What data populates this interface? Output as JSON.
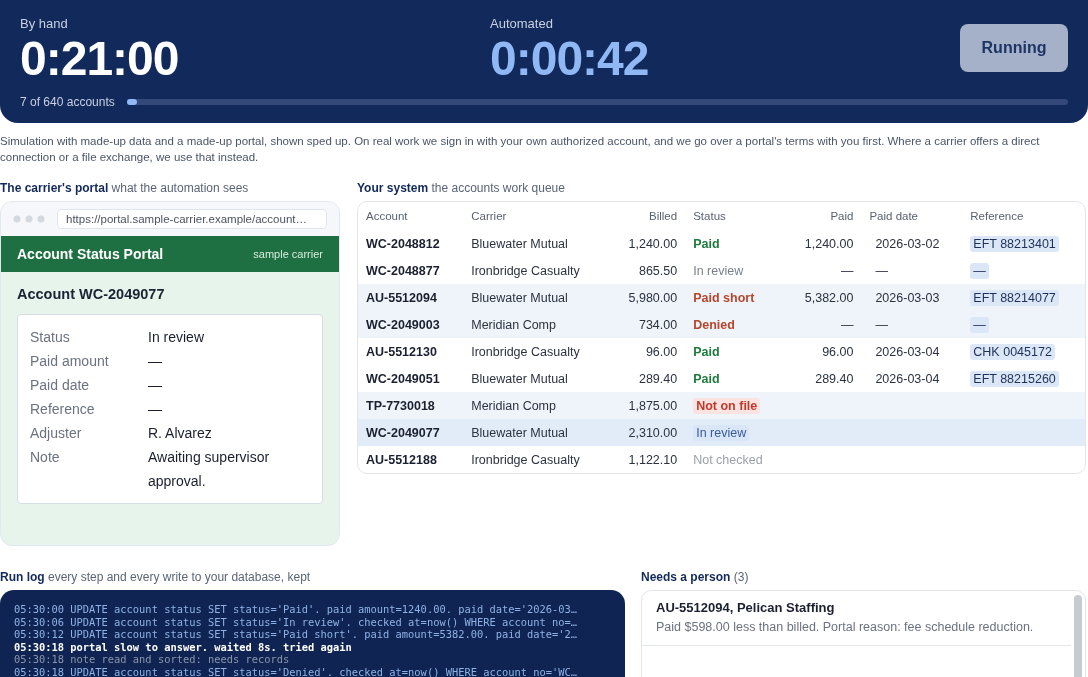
{
  "header": {
    "by_hand": {
      "label": "By hand",
      "time": "0:21:00"
    },
    "automated": {
      "label": "Automated",
      "time": "0:00:42"
    },
    "button": "Running",
    "progress": {
      "label": "7 of 640 accounts",
      "level": 0.011
    }
  },
  "notice": "Simulation with made-up data and a made-up portal, shown sped up. On real work we sign in with your own authorized account, and we go over a portal's terms with you first. Where a carrier offers a direct connection or a file exchange, we use that instead.",
  "portal": {
    "heading": "The carrier's portal",
    "subheading": "what the automation sees",
    "url": "https://portal.sample-carrier.example/account…",
    "title": "Account Status Portal",
    "tag": "sample carrier",
    "account": "Account WC-2049077",
    "fields": [
      {
        "label": "Status",
        "value": "In review"
      },
      {
        "label": "Paid amount",
        "value": "—"
      },
      {
        "label": "Paid date",
        "value": "—"
      },
      {
        "label": "Reference",
        "value": "—"
      },
      {
        "label": "Adjuster",
        "value": "R. Alvarez"
      },
      {
        "label": "Note",
        "value": "Awaiting supervisor approval."
      }
    ]
  },
  "queue": {
    "heading": "Your system",
    "subheading": "the accounts work queue",
    "columns": [
      "Account",
      "Carrier",
      "Billed",
      "Status",
      "Paid",
      "Paid date",
      "Reference"
    ],
    "rows": [
      {
        "account": "WC-2048812",
        "carrier": "Bluewater Mutual",
        "billed": "1,240.00",
        "status": "Paid",
        "kind": "paid",
        "paid": "1,240.00",
        "date": "2026-03-02",
        "reference": "EFT 88213401",
        "flagged": false,
        "selected": false
      },
      {
        "account": "WC-2048877",
        "carrier": "Ironbridge Casualty",
        "billed": "865.50",
        "status": "In review",
        "kind": "review",
        "paid": "—",
        "date": "—",
        "reference": "—",
        "flagged": false,
        "selected": false
      },
      {
        "account": "AU-5512094",
        "carrier": "Bluewater Mutual",
        "billed": "5,980.00",
        "status": "Paid short",
        "kind": "short",
        "paid": "5,382.00",
        "date": "2026-03-03",
        "reference": "EFT 88214077",
        "flagged": true,
        "selected": false
      },
      {
        "account": "WC-2049003",
        "carrier": "Meridian Comp",
        "billed": "734.00",
        "status": "Denied",
        "kind": "denied",
        "paid": "—",
        "date": "—",
        "reference": "—",
        "flagged": true,
        "selected": false
      },
      {
        "account": "AU-5512130",
        "carrier": "Ironbridge Casualty",
        "billed": "96.00",
        "status": "Paid",
        "kind": "paid",
        "paid": "96.00",
        "date": "2026-03-04",
        "reference": "CHK 0045172",
        "flagged": false,
        "selected": false
      },
      {
        "account": "WC-2049051",
        "carrier": "Bluewater Mutual",
        "billed": "289.40",
        "status": "Paid",
        "kind": "paid",
        "paid": "289.40",
        "date": "2026-03-04",
        "reference": "EFT 88215260",
        "flagged": false,
        "selected": false
      },
      {
        "account": "TP-7730018",
        "carrier": "Meridian Comp",
        "billed": "1,875.00",
        "status": "Not on file",
        "kind": "missing",
        "flagged": true,
        "selected": false
      },
      {
        "account": "WC-2049077",
        "carrier": "Bluewater Mutual",
        "billed": "2,310.00",
        "status": "In review",
        "kind": "review",
        "flagged": false,
        "selected": true
      },
      {
        "account": "AU-5512188",
        "carrier": "Ironbridge Casualty",
        "billed": "1,122.10",
        "status": "Not checked",
        "kind": "unchecked",
        "flagged": false,
        "selected": false
      }
    ]
  },
  "log": {
    "heading": "Run log",
    "subheading": "every step and every write to your database, kept",
    "lines": [
      {
        "kind": "write",
        "text": "05:30:00 UPDATE account status SET status='Paid'. paid amount=1240.00. paid date='2026-03…"
      },
      {
        "kind": "write",
        "text": "05:30:06 UPDATE account status SET status='In review'. checked at=now() WHERE account no=…"
      },
      {
        "kind": "write",
        "text": "05:30:12 UPDATE account status SET status='Paid short'. paid amount=5382.00. paid date='2…"
      },
      {
        "kind": "warn",
        "text": "05:30:18 portal slow to answer. waited 8s. tried again"
      },
      {
        "kind": "note",
        "text": "05:30:18 note read and sorted: needs records"
      },
      {
        "kind": "write",
        "text": "05:30:18 UPDATE account status SET status='Denied'. checked at=now() WHERE account no='WC…"
      }
    ]
  },
  "needs": {
    "heading": "Needs a person",
    "count": "(3)",
    "items": [
      {
        "title": "AU-5512094, Pelican Staffing",
        "text": "Paid $598.00 less than billed. Portal reason: fee schedule reduction."
      }
    ]
  }
}
